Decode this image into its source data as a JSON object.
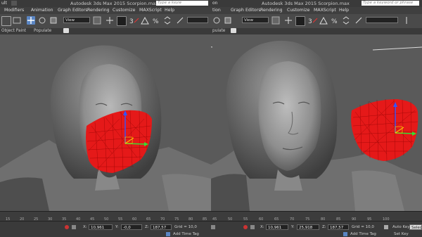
{
  "left": {
    "title_prefix": "ult",
    "title": "Autodesk 3ds Max 2015    Scorpion.max",
    "search_placeholder": "Type a keyw",
    "menu": [
      "Modifiers",
      "Animation",
      "Graph Editors",
      "Rendering",
      "Customize",
      "MAXScript",
      "Help"
    ],
    "view_dropdown": "View",
    "ribbon": {
      "object_paint": "Object Paint",
      "populate": "Populate"
    },
    "timeline_ticks": [
      "15",
      "20",
      "25",
      "30",
      "35",
      "40",
      "45",
      "50",
      "55",
      "60",
      "65",
      "70",
      "75",
      "80",
      "85"
    ],
    "status": {
      "x_label": "X:",
      "x": "10,961",
      "y_label": "Y:",
      "y": "-0,0",
      "z_label": "Z:",
      "z": "187,57",
      "grid": "Grid = 10,0",
      "add_time_tag": "Add Time Tag"
    }
  },
  "right": {
    "title_prefix": "on",
    "title": "Autodesk 3ds Max 2015    Scorpion.max",
    "search_placeholder": "Type a keyword or phrase",
    "menu": [
      "tion",
      "Graph Editors",
      "Rendering",
      "Customize",
      "MAXScript",
      "Help"
    ],
    "view_dropdown": "View",
    "ribbon": {
      "populate": "pulate"
    },
    "timeline_ticks": [
      "45",
      "50",
      "55",
      "60",
      "65",
      "70",
      "75",
      "80",
      "85",
      "90",
      "95",
      "100"
    ],
    "status": {
      "x_label": "X:",
      "x": "10,961",
      "y_label": "Y:",
      "y": "25,918",
      "z_label": "Z:",
      "z": "187,57",
      "grid": "Grid = 10,0",
      "add_time_tag": "Add Time Tag",
      "auto_key": "Auto Key",
      "selected": "Selecte",
      "set_key": "Set Key"
    }
  },
  "colors": {
    "mesh_red": "#e51919",
    "viewport_bg": "#5a5a5a",
    "ui_dark": "#3a3a3a",
    "gizmo_x": "#ff3333",
    "gizmo_y": "#33dd33",
    "gizmo_z": "#3355ff"
  }
}
